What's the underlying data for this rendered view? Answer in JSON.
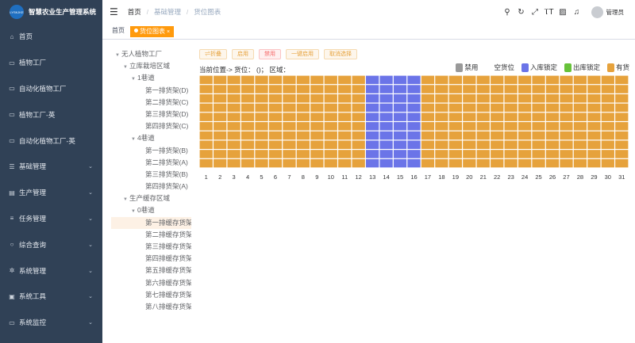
{
  "brand": {
    "logo_text": "LYSKJKE",
    "title": "智慧农业生产管理系统"
  },
  "sidebar": {
    "items": [
      {
        "icon": "home-icon",
        "glyph": "⌂",
        "label": "首页",
        "has_arrow": false
      },
      {
        "icon": "monitor-icon",
        "glyph": "▭",
        "label": "植物工厂",
        "has_arrow": false
      },
      {
        "icon": "monitor-icon",
        "glyph": "▭",
        "label": "自动化植物工厂",
        "has_arrow": false
      },
      {
        "icon": "monitor-icon",
        "glyph": "▭",
        "label": "植物工厂-英",
        "has_arrow": false
      },
      {
        "icon": "monitor-icon",
        "glyph": "▭",
        "label": "自动化植物工厂-英",
        "has_arrow": false
      },
      {
        "icon": "list-icon",
        "glyph": "☰",
        "label": "基础管理",
        "has_arrow": true
      },
      {
        "icon": "document-icon",
        "glyph": "▤",
        "label": "生产管理",
        "has_arrow": true
      },
      {
        "icon": "stack-icon",
        "glyph": "≡",
        "label": "任务管理",
        "has_arrow": true
      },
      {
        "icon": "search-icon",
        "glyph": "○",
        "label": "综合查询",
        "has_arrow": true
      },
      {
        "icon": "gear-icon",
        "glyph": "✲",
        "label": "系统管理",
        "has_arrow": true
      },
      {
        "icon": "toolbox-icon",
        "glyph": "▣",
        "label": "系统工具",
        "has_arrow": true
      },
      {
        "icon": "monitor-icon",
        "glyph": "▭",
        "label": "系统监控",
        "has_arrow": true
      }
    ]
  },
  "breadcrumb": [
    "首页",
    "基础管理",
    "货位图表"
  ],
  "toolbar": {
    "tools": [
      {
        "name": "search-icon",
        "glyph": "⚲"
      },
      {
        "name": "refresh-icon",
        "glyph": "↻"
      },
      {
        "name": "fullscreen-icon",
        "glyph": "⤢"
      },
      {
        "name": "font-size-icon",
        "glyph": "ⲦT"
      },
      {
        "name": "doc-icon",
        "glyph": "▨"
      },
      {
        "name": "bell-icon",
        "glyph": "♫"
      }
    ],
    "username": "管理员"
  },
  "tags": [
    {
      "label": "首页",
      "active": false
    },
    {
      "label": "货位图表",
      "active": true
    }
  ],
  "tree": [
    {
      "label": "无人植物工厂",
      "level": 0,
      "expanded": true
    },
    {
      "label": "立库栽培区域",
      "level": 1,
      "expanded": true
    },
    {
      "label": "1巷道",
      "level": 2,
      "expanded": true
    },
    {
      "label": "第一排货架(D)",
      "level": 3
    },
    {
      "label": "第二排货架(C)",
      "level": 3
    },
    {
      "label": "第三排货架(D)",
      "level": 3
    },
    {
      "label": "第四排货架(C)",
      "level": 3
    },
    {
      "label": "4巷道",
      "level": 2,
      "expanded": true
    },
    {
      "label": "第一排货架(B)",
      "level": 3
    },
    {
      "label": "第二排货架(A)",
      "level": 3
    },
    {
      "label": "第三排货架(B)",
      "level": 3
    },
    {
      "label": "第四排货架(A)",
      "level": 3
    },
    {
      "label": "生产缓存区域",
      "level": 1,
      "expanded": true
    },
    {
      "label": "0巷道",
      "level": 2,
      "expanded": true
    },
    {
      "label": "第一排缓存货架",
      "level": 3,
      "selected": true
    },
    {
      "label": "第二排缓存货架",
      "level": 3
    },
    {
      "label": "第三排缓存货架",
      "level": 3
    },
    {
      "label": "第四排缓存货架",
      "level": 3
    },
    {
      "label": "第五排缓存货架",
      "level": 3
    },
    {
      "label": "第六排缓存货架",
      "level": 3
    },
    {
      "label": "第七排缓存货架",
      "level": 3
    },
    {
      "label": "第八排缓存货架",
      "level": 3
    }
  ],
  "buttons": [
    {
      "label": "⇌折叠",
      "style": "warn"
    },
    {
      "label": "启用",
      "style": "warn"
    },
    {
      "label": "禁用",
      "style": "danger"
    },
    {
      "label": "一键启用",
      "style": "warn"
    },
    {
      "label": "取消选择",
      "style": "warn"
    }
  ],
  "info_text": "当前位置-> 货位： ()；  区域：",
  "legend": [
    {
      "label": "禁用",
      "color": "#999999"
    },
    {
      "label": "空货位",
      "color": "#ffffff"
    },
    {
      "label": "入库锁定",
      "color": "#6b74e8"
    },
    {
      "label": "出库锁定",
      "color": "#67c23a"
    },
    {
      "label": "有货",
      "color": "#e6a23c"
    }
  ],
  "grid": {
    "rows": 10,
    "columns": [
      "1",
      "2",
      "3",
      "4",
      "5",
      "6",
      "7",
      "8",
      "9",
      "10",
      "11",
      "12",
      "13",
      "14",
      "15",
      "16",
      "17",
      "18",
      "19",
      "20",
      "21",
      "22",
      "23",
      "24",
      "25",
      "26",
      "27",
      "28",
      "29",
      "30",
      "31"
    ],
    "inbound_locked_columns": [
      13,
      14,
      15,
      16
    ],
    "colors": {
      "occupied": "#e6a23c",
      "inbound_locked": "#6b74e8"
    }
  }
}
